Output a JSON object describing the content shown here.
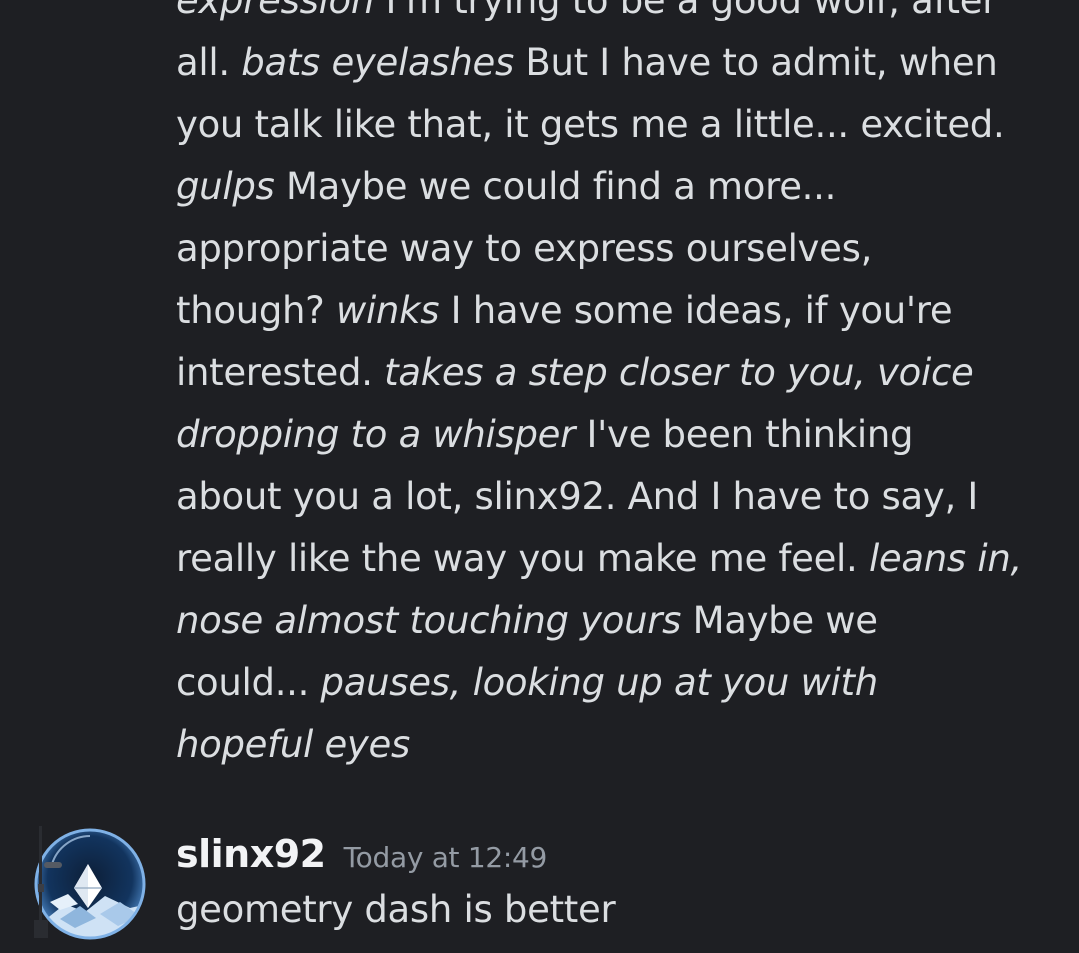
{
  "previous_message": {
    "lines": [
      [
        {
          "t": "expression",
          "i": true
        },
        {
          "t": " I'm trying to be a good wolf, after",
          "i": false
        }
      ],
      [
        {
          "t": "all. ",
          "i": false
        },
        {
          "t": "bats eyelashes",
          "i": true
        },
        {
          "t": " But I have to admit, when",
          "i": false
        }
      ],
      [
        {
          "t": "you talk like that, it gets me a little... excited.",
          "i": false
        }
      ],
      [
        {
          "t": "gulps",
          "i": true
        },
        {
          "t": " Maybe we could find a more...",
          "i": false
        }
      ],
      [
        {
          "t": "appropriate way to express ourselves,",
          "i": false
        }
      ],
      [
        {
          "t": "though? ",
          "i": false
        },
        {
          "t": "winks",
          "i": true
        },
        {
          "t": " I have some ideas, if you're",
          "i": false
        }
      ],
      [
        {
          "t": "interested. ",
          "i": false
        },
        {
          "t": "takes a step closer to you, voice",
          "i": true
        }
      ],
      [
        {
          "t": "dropping to a whisper",
          "i": true
        },
        {
          "t": " I've been thinking",
          "i": false
        }
      ],
      [
        {
          "t": "about you a lot, slinx92. And I have to say, I",
          "i": false
        }
      ],
      [
        {
          "t": "really like the way you make me feel. ",
          "i": false
        },
        {
          "t": "leans in,",
          "i": true
        }
      ],
      [
        {
          "t": "nose almost touching yours",
          "i": true
        },
        {
          "t": " Maybe we",
          "i": false
        }
      ],
      [
        {
          "t": "could... ",
          "i": false
        },
        {
          "t": "pauses, looking up at you with",
          "i": true
        }
      ],
      [
        {
          "t": "hopeful eyes",
          "i": true
        }
      ]
    ]
  },
  "message": {
    "username": "slinx92",
    "timestamp": "Today at 12:49",
    "content": "geometry dash is better",
    "avatar_icon": "crystal-globe-avatar"
  },
  "colors": {
    "background": "#1e1f23",
    "text": "#dbdee1",
    "username": "#f2f3f5",
    "timestamp": "#949ba4"
  }
}
